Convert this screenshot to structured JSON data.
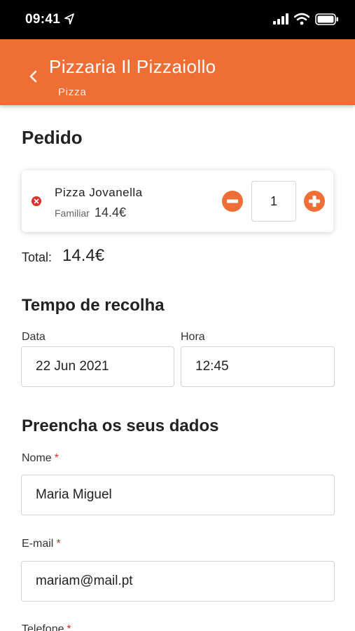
{
  "status_bar": {
    "time": "09:41"
  },
  "header": {
    "title": "Pizzaria Il Pizzaiollo",
    "subtitle": "Pizza",
    "accent_color": "#ee6e36"
  },
  "order": {
    "title": "Pedido",
    "items": [
      {
        "name": "Pizza Jovanella",
        "size": "Familiar",
        "price": "14.4€",
        "quantity": "1"
      }
    ],
    "total_label": "Total:",
    "total_value": "14.4€"
  },
  "pickup": {
    "title": "Tempo de recolha",
    "date_label": "Data",
    "date_value": "22 Jun 2021",
    "time_label": "Hora",
    "time_value": "12:45"
  },
  "customer": {
    "title": "Preencha os seus dados",
    "name_label": "Nome",
    "name_value": "Maria Miguel",
    "email_label": "E-mail",
    "email_value": "mariam@mail.pt",
    "phone_label": "Telefone",
    "required_mark": "*"
  },
  "icons": {
    "back": "chevron-left-icon",
    "remove": "close-circle-icon",
    "minus": "minus-circle-icon",
    "plus": "plus-circle-icon"
  }
}
